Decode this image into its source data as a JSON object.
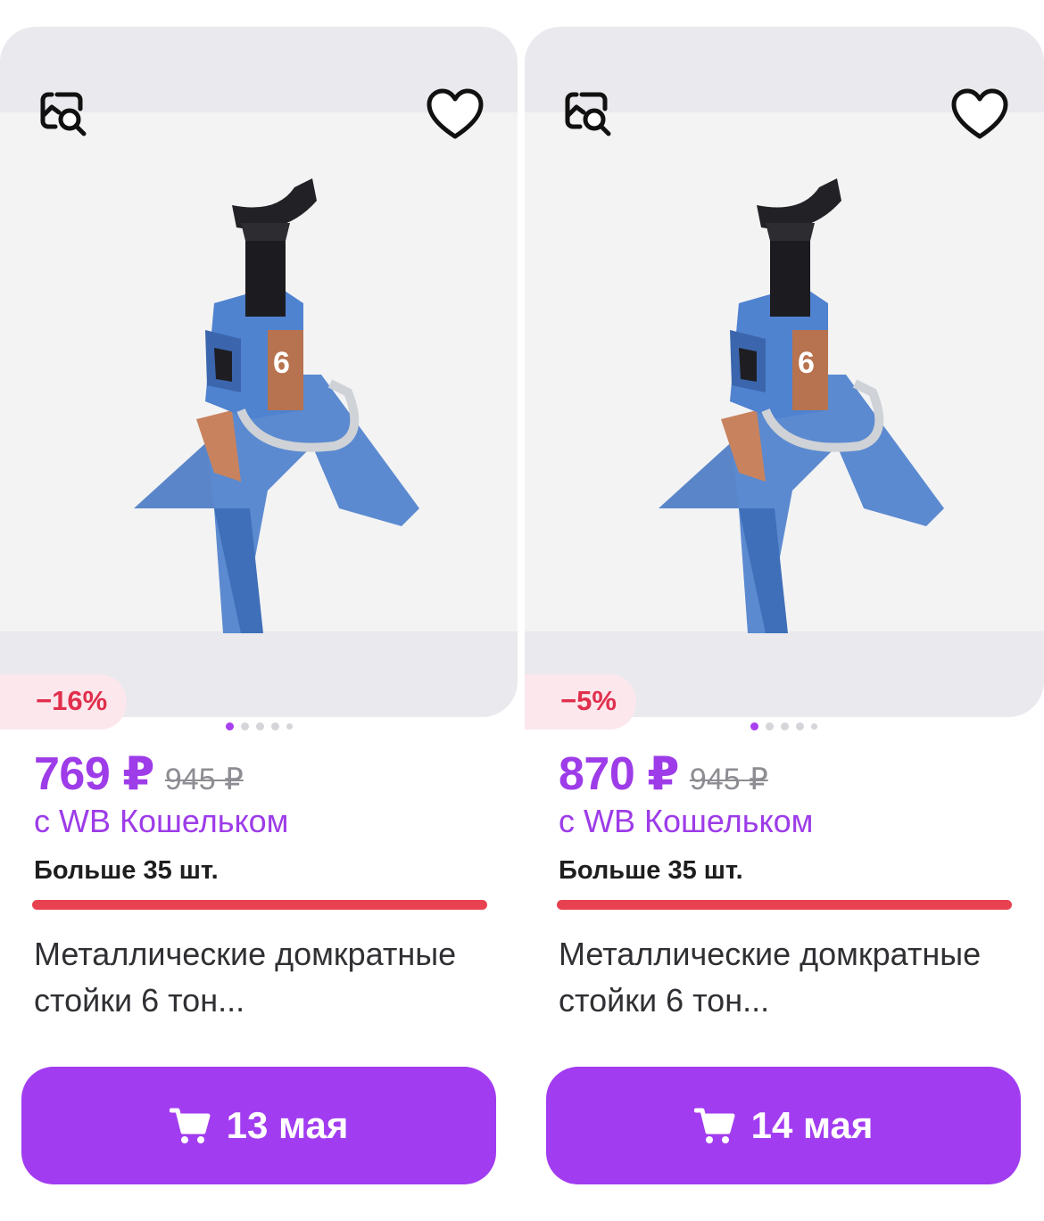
{
  "colors": {
    "accent": "#a23cf0",
    "price": "#9d3ce8",
    "discount_text": "#e12f4d",
    "discount_bg": "#fbe7ec",
    "stock_bar": "#e84250"
  },
  "icons": {
    "similar": "image-search-icon",
    "favorite": "heart-icon",
    "cart": "cart-icon"
  },
  "products": [
    {
      "discount": "−16%",
      "price": "769 ₽",
      "old_price": "945 ₽",
      "wallet_label": "с WB Кошельком",
      "stock": "Больше 35 шт.",
      "title": "Металлические домкратные стойки 6 тон...",
      "delivery": "13 мая",
      "image_dots": 5,
      "image_active_dot": 1
    },
    {
      "discount": "−5%",
      "price": "870 ₽",
      "old_price": "945 ₽",
      "wallet_label": "с WB Кошельком",
      "stock": "Больше 35 шт.",
      "title": "Металлические домкратные стойки 6 тон...",
      "delivery": "14 мая",
      "image_dots": 5,
      "image_active_dot": 1
    }
  ]
}
